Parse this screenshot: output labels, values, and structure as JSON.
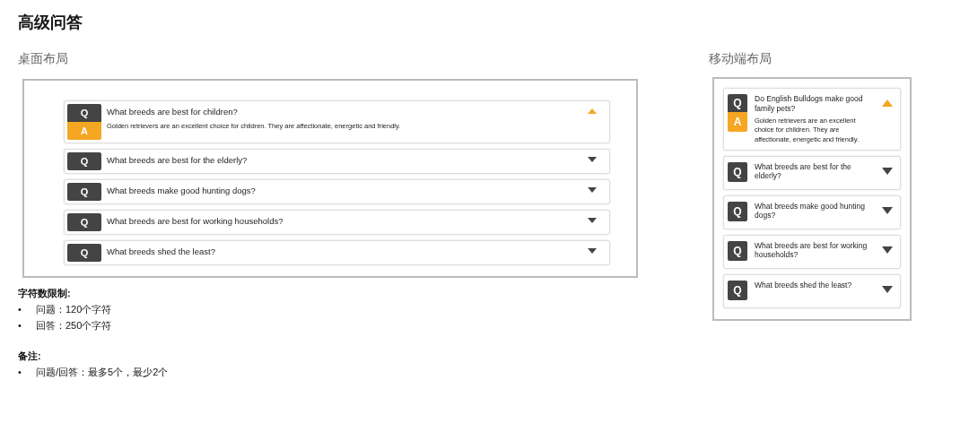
{
  "title": "高级问答",
  "desktop": {
    "heading": "桌面布局",
    "items": [
      {
        "q_badge": "Q",
        "question": "What breeds are best for children?",
        "a_badge": "A",
        "answer": "Golden retrievers are an excellent choice for children. They are affectionate, energetic and friendly.",
        "expanded": true
      },
      {
        "q_badge": "Q",
        "question": "What breeds are best for the elderly?",
        "expanded": false
      },
      {
        "q_badge": "Q",
        "question": "What breeds make good hunting dogs?",
        "expanded": false
      },
      {
        "q_badge": "Q",
        "question": "What breeds are best for working households?",
        "expanded": false
      },
      {
        "q_badge": "Q",
        "question": "What breeds shed the least?",
        "expanded": false
      }
    ]
  },
  "mobile": {
    "heading": "移动端布局",
    "items": [
      {
        "q_badge": "Q",
        "question": "Do English Bulldogs make good family pets?",
        "a_badge": "A",
        "answer": "Golden retrievers are an excellent choice for children. They are affectionate, energetic and friendly.",
        "expanded": true
      },
      {
        "q_badge": "Q",
        "question": "What breeds are best for the elderly?",
        "expanded": false
      },
      {
        "q_badge": "Q",
        "question": "What breeds make good hunting dogs?",
        "expanded": false
      },
      {
        "q_badge": "Q",
        "question": "What breeds are best for working households?",
        "expanded": false
      },
      {
        "q_badge": "Q",
        "question": "What breeds shed the least?",
        "expanded": false
      }
    ]
  },
  "notes": [
    {
      "heading": "字符数限制:",
      "items": [
        {
          "bullet": "•",
          "text": "问题：120个字符"
        },
        {
          "bullet": "•",
          "text": "回答：250个字符"
        }
      ]
    },
    {
      "heading": "备注:",
      "items": [
        {
          "bullet": "•",
          "text": "问题/回答：最多5个，最少2个"
        }
      ]
    }
  ]
}
